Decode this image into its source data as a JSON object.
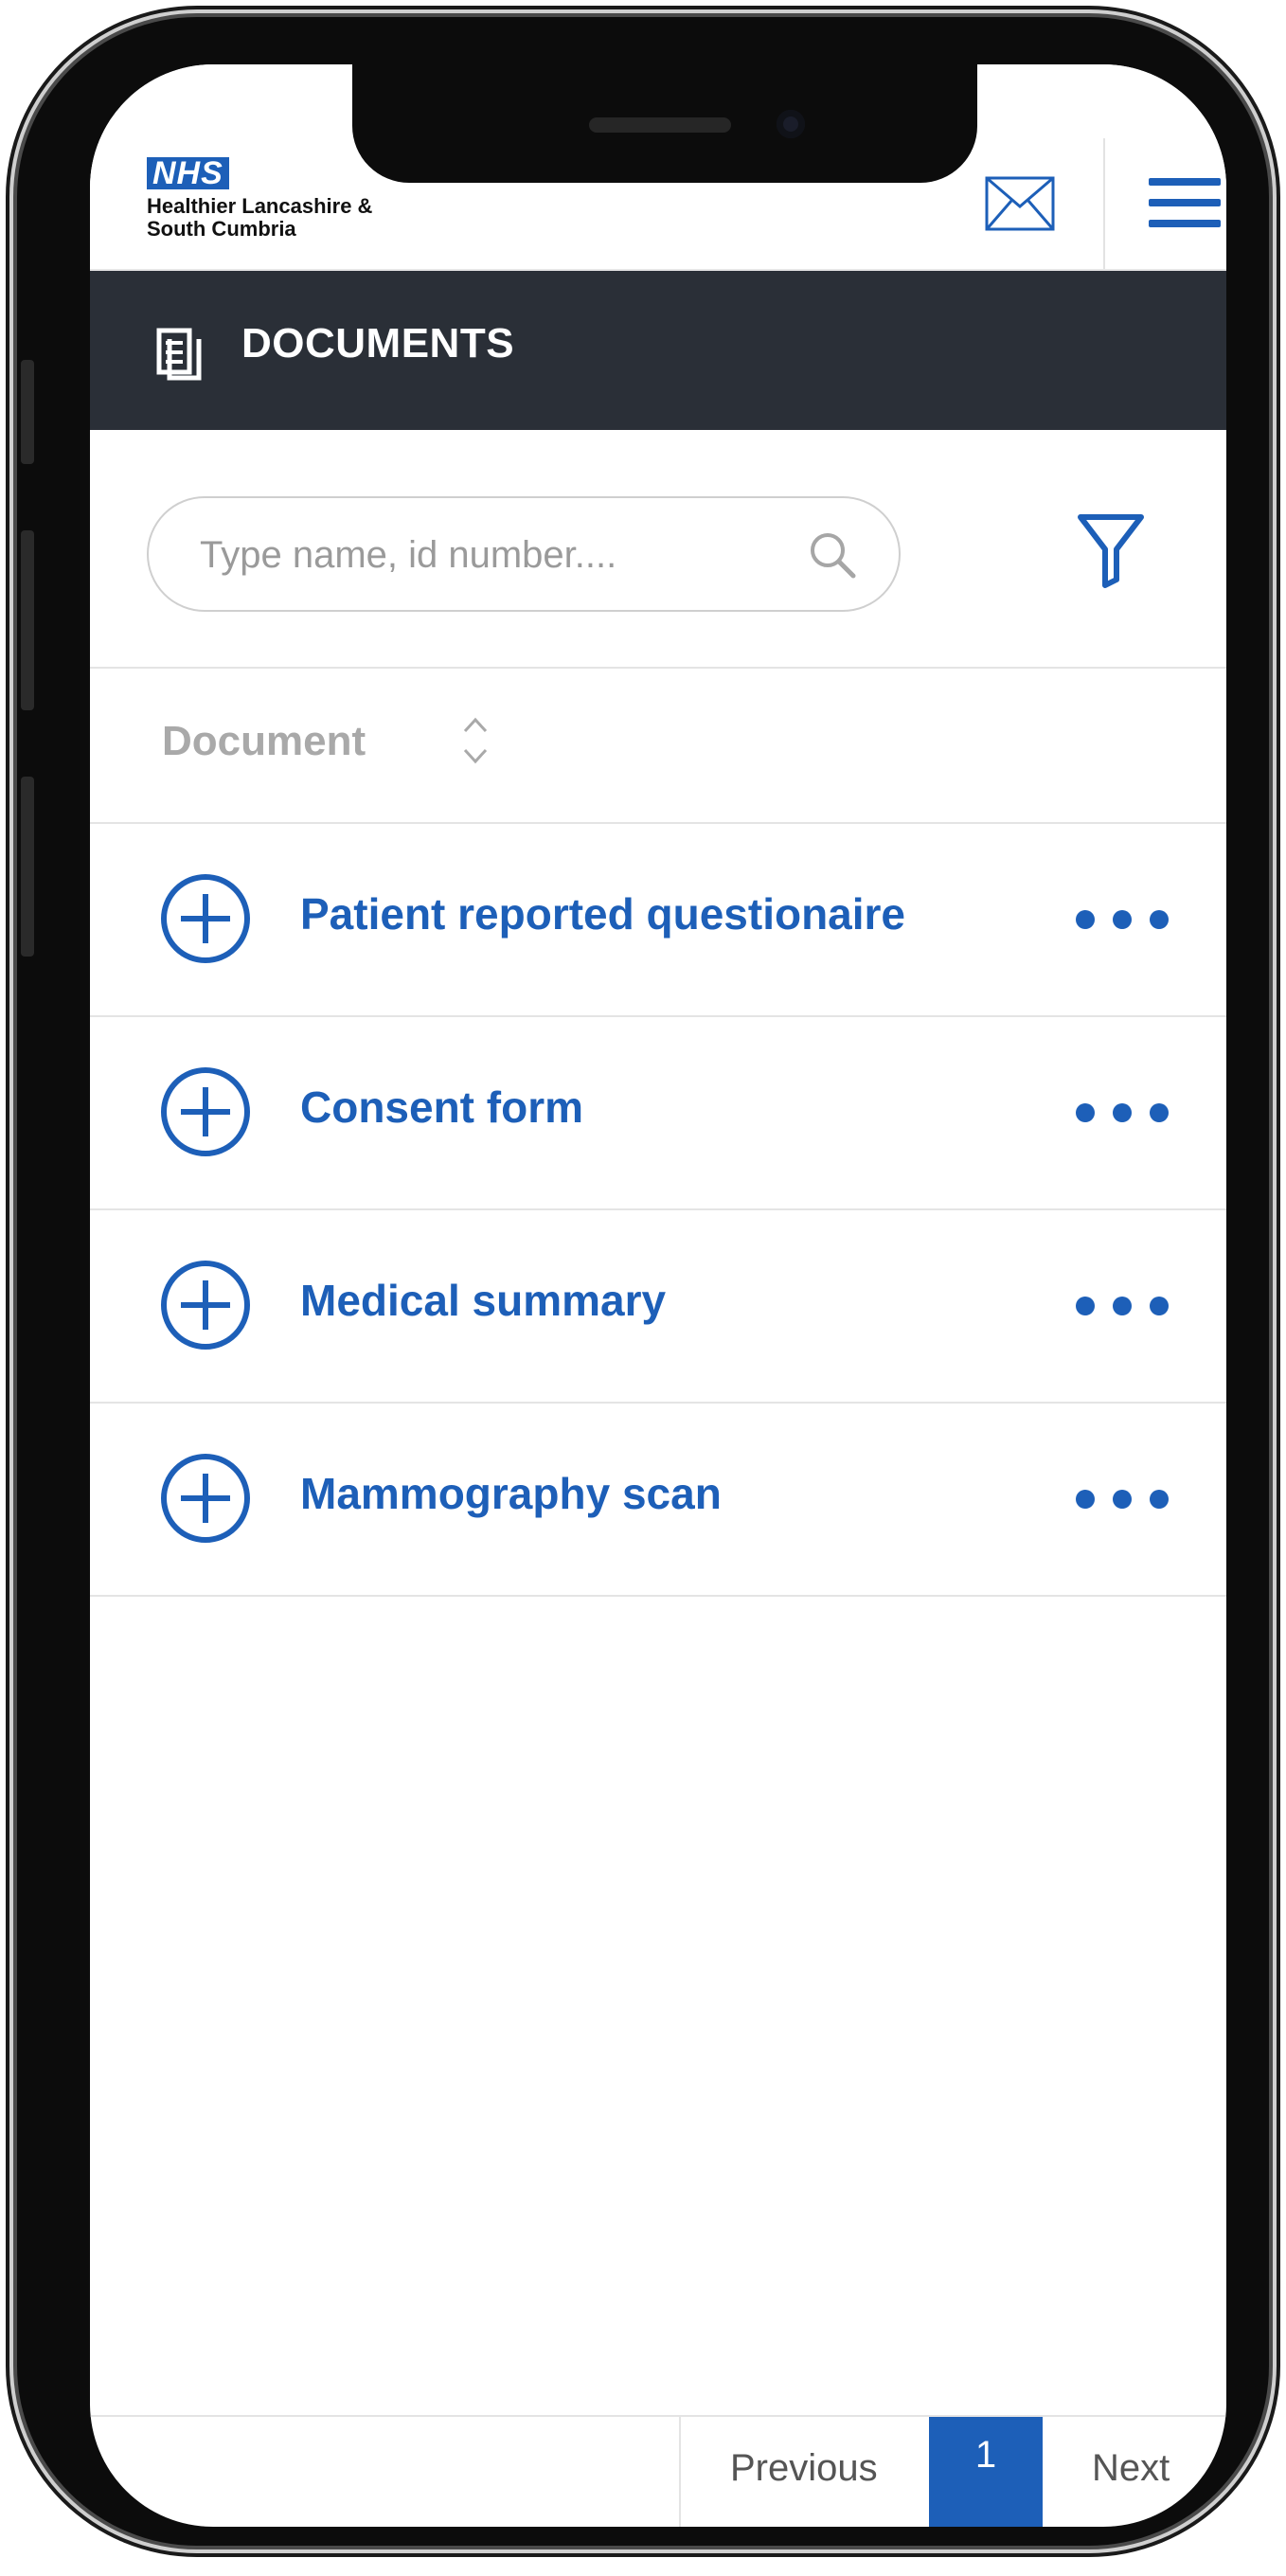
{
  "header": {
    "brand_badge": "NHS",
    "org_line_1": "Healthier Lancashire &",
    "org_line_2": "South Cumbria"
  },
  "title_bar": {
    "title": "DOCUMENTS",
    "icon": "documents-icon"
  },
  "search": {
    "placeholder": "Type name, id number....",
    "value": ""
  },
  "table": {
    "column_header": "Document",
    "rows": [
      {
        "label": "Patient reported questionaire"
      },
      {
        "label": "Consent form"
      },
      {
        "label": "Medical summary"
      },
      {
        "label": "Mammography scan"
      }
    ]
  },
  "pagination": {
    "previous_label": "Previous",
    "current_page": "1",
    "next_label": "Next"
  },
  "colors": {
    "brand_blue": "#1d5fb8",
    "title_bar_bg": "#2a2f37",
    "muted_text": "#a9a9a9"
  }
}
